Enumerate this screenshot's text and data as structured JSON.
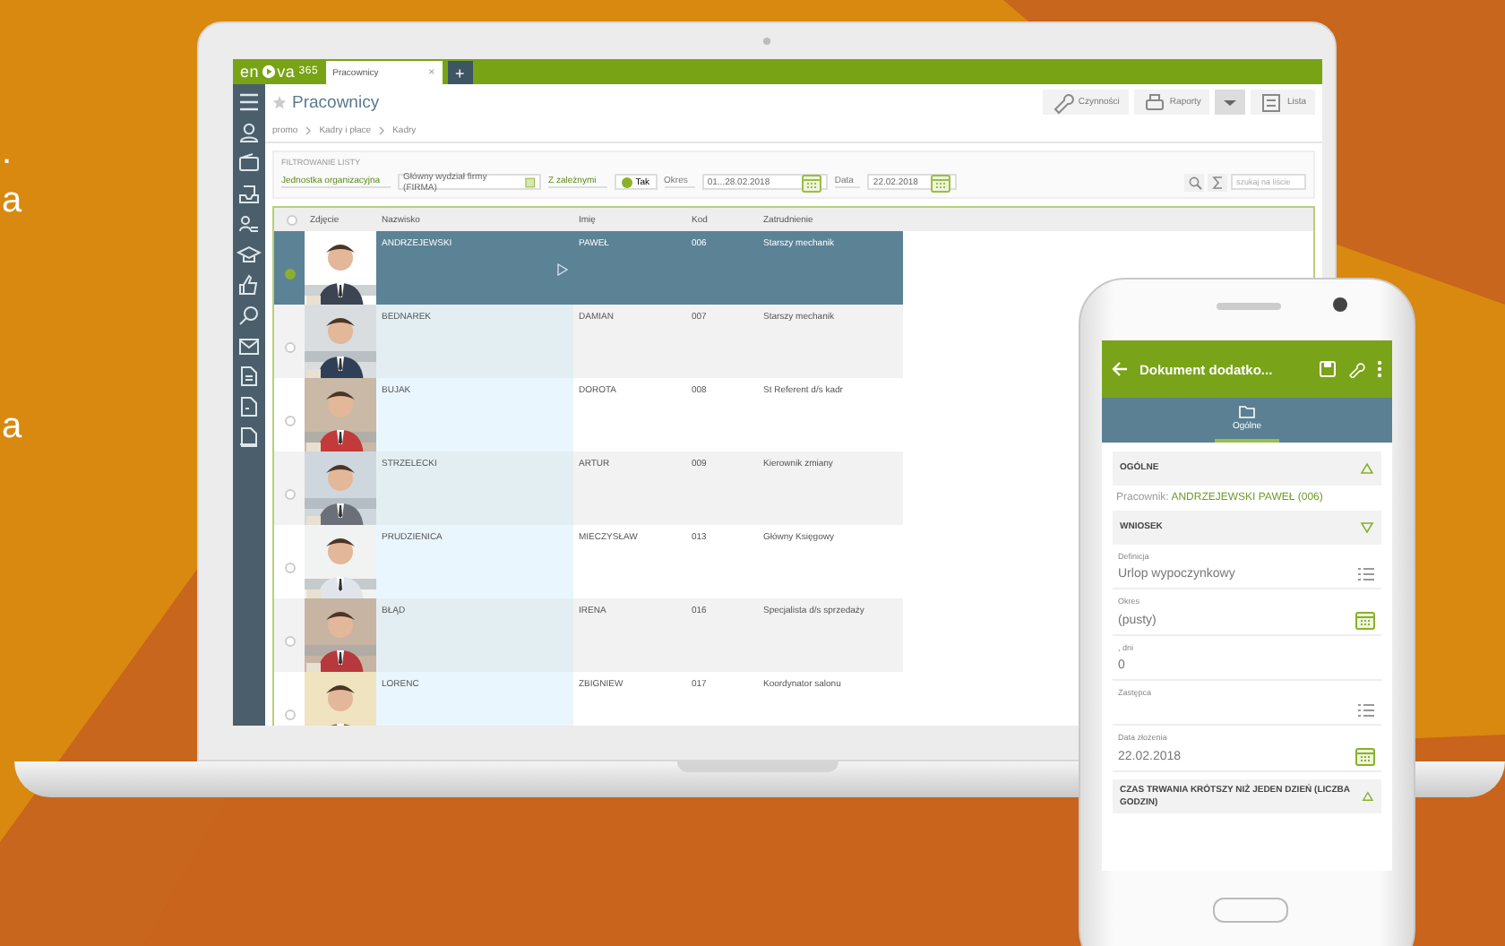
{
  "edge_texts": [
    ".",
    "a",
    "a"
  ],
  "laptop": {
    "logo": [
      "en",
      "va",
      "365"
    ],
    "tabs": [
      {
        "label": "Pracownicy",
        "selected": true,
        "close": "×"
      }
    ],
    "add_tab": "+",
    "title": "Pracownicy",
    "toolbar": [
      {
        "kind": "wrench",
        "label": "Czynności"
      },
      {
        "kind": "printer",
        "label": "Raporty"
      },
      {
        "kind": "dropdown"
      },
      {
        "kind": "list",
        "label": "Lista"
      }
    ],
    "breadcrumb": [
      "promo",
      "Kadry i płace",
      "Kadry"
    ],
    "filter": {
      "title": "FILTROWANIE LISTY",
      "unit_label": "Jednostka organizacyjna",
      "unit_value": "Główny wydział firmy (FIRMA)",
      "sub_label": "Z zależnymi",
      "sub_value": "Tak",
      "sub_checked": true,
      "period_label": "Okres",
      "period_value": "01...28.02.2018",
      "date_label": "Data",
      "date_value": "22.02.2018",
      "search_placeholder": "szukaj na liście"
    },
    "table": {
      "all_selected": false,
      "columns": [
        "Zdjęcie",
        "Nazwisko",
        "Imię",
        "Kod",
        "Zatrudnienie"
      ],
      "rows": [
        {
          "selected": true,
          "cells": [
            "",
            "ANDRZEJEWSKI",
            "PAWEŁ",
            "006",
            "Starszy mechanik"
          ]
        },
        {
          "selected": false,
          "cells": [
            "",
            "BEDNAREK",
            "DAMIAN",
            "007",
            "Starszy mechanik"
          ]
        },
        {
          "selected": false,
          "cells": [
            "",
            "BUJAK",
            "DOROTA",
            "008",
            "St Referent d/s kadr"
          ]
        },
        {
          "selected": false,
          "cells": [
            "",
            "STRZELECKI",
            "ARTUR",
            "009",
            "Kierownik zmiany"
          ]
        },
        {
          "selected": false,
          "cells": [
            "",
            "PRUDZIENICA",
            "MIECZYSŁAW",
            "013",
            "Główny Księgowy"
          ]
        },
        {
          "selected": false,
          "cells": [
            "",
            "BŁĄD",
            "IRENA",
            "016",
            "Specjalista d/s sprzedaży"
          ]
        },
        {
          "selected": false,
          "cells": [
            "",
            "LORENC",
            "ZBIGNIEW",
            "017",
            "Koordynator salonu"
          ]
        }
      ]
    }
  },
  "phone": {
    "title": "Dokument dodatko...",
    "tab": {
      "label": "Ogólne",
      "selected": true
    },
    "sections": [
      {
        "title": "OGÓLNE",
        "expanded": true,
        "items": [
          {
            "kind": "info",
            "label": "Pracownik:",
            "value": "ANDRZEJEWSKI PAWEŁ (006)"
          }
        ]
      },
      {
        "title": "WNIOSEK",
        "expanded": false,
        "items": [
          {
            "kind": "list",
            "label": "Definicja",
            "value": "Urlop wypoczynkowy"
          },
          {
            "kind": "date",
            "label": "Okres",
            "value": "(pusty)"
          },
          {
            "kind": "text",
            "label": ", dni",
            "value": "0"
          },
          {
            "kind": "list",
            "label": "Zastępca"
          },
          {
            "kind": "date",
            "label": "Data złożenia",
            "value": "22.02.2018"
          }
        ]
      },
      {
        "title": "CZAS TRWANIA KRÓTSZY NIŻ JEDEN DZIEŃ (LICZBA GODZIN)",
        "expanded": true
      }
    ]
  }
}
